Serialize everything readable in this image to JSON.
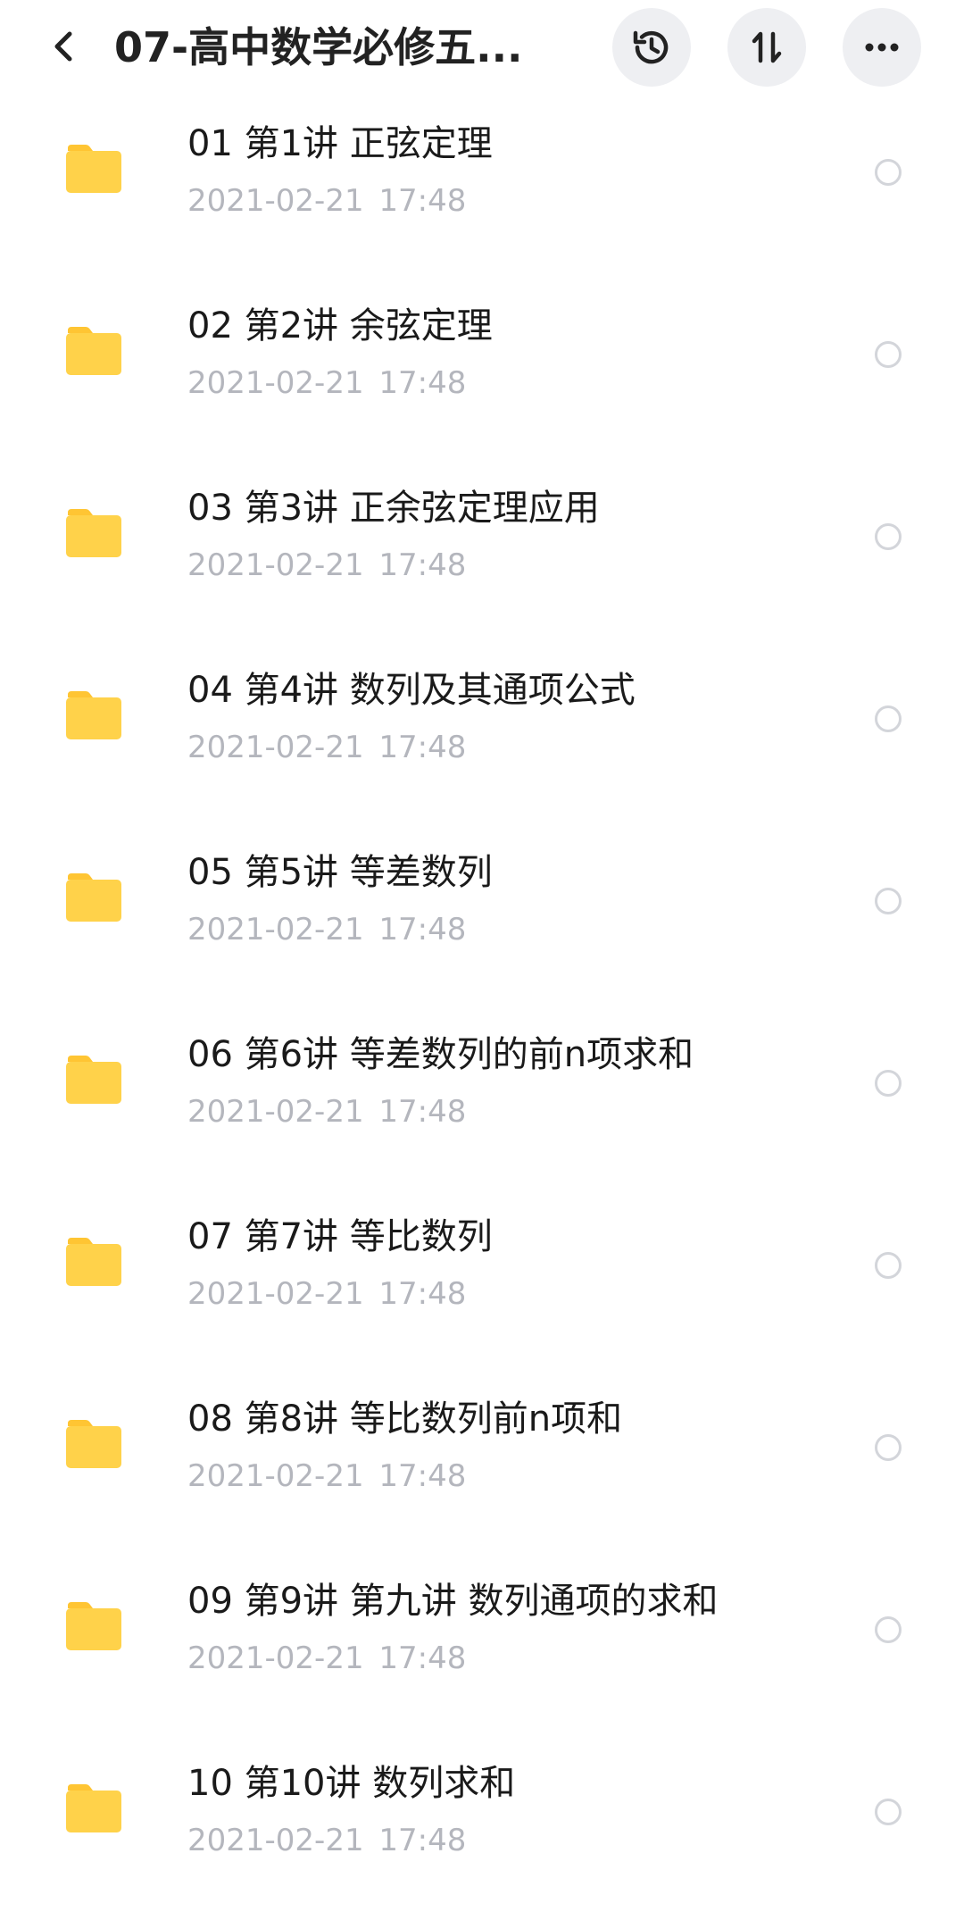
{
  "header": {
    "title": "07-高中数学必修五...",
    "back_icon": "chevron-left-icon",
    "history_icon": "history-icon",
    "sort_icon": "sort-icon",
    "more_icon": "more-horizontal-icon"
  },
  "colors": {
    "folder": "#FFD24A",
    "folder_tab": "#FFC533",
    "header_button_bg": "#EEEFF2",
    "date_text": "#B4B6BD"
  },
  "files": [
    {
      "name": "01 第1讲 正弦定理",
      "date": "2021-02-21  17:48",
      "icon": "folder-icon"
    },
    {
      "name": "02 第2讲 余弦定理",
      "date": "2021-02-21  17:48",
      "icon": "folder-icon"
    },
    {
      "name": "03 第3讲 正余弦定理应用",
      "date": "2021-02-21  17:48",
      "icon": "folder-icon"
    },
    {
      "name": "04 第4讲 数列及其通项公式",
      "date": "2021-02-21  17:48",
      "icon": "folder-icon"
    },
    {
      "name": "05 第5讲 等差数列",
      "date": "2021-02-21  17:48",
      "icon": "folder-icon"
    },
    {
      "name": "06 第6讲 等差数列的前n项求和",
      "date": "2021-02-21  17:48",
      "icon": "folder-icon"
    },
    {
      "name": "07 第7讲 等比数列",
      "date": "2021-02-21  17:48",
      "icon": "folder-icon"
    },
    {
      "name": "08 第8讲 等比数列前n项和",
      "date": "2021-02-21  17:48",
      "icon": "folder-icon"
    },
    {
      "name": "09 第9讲 第九讲 数列通项的求和",
      "date": "2021-02-21  17:48",
      "icon": "folder-icon"
    },
    {
      "name": "10 第10讲 数列求和",
      "date": "2021-02-21  17:48",
      "icon": "folder-icon"
    }
  ]
}
